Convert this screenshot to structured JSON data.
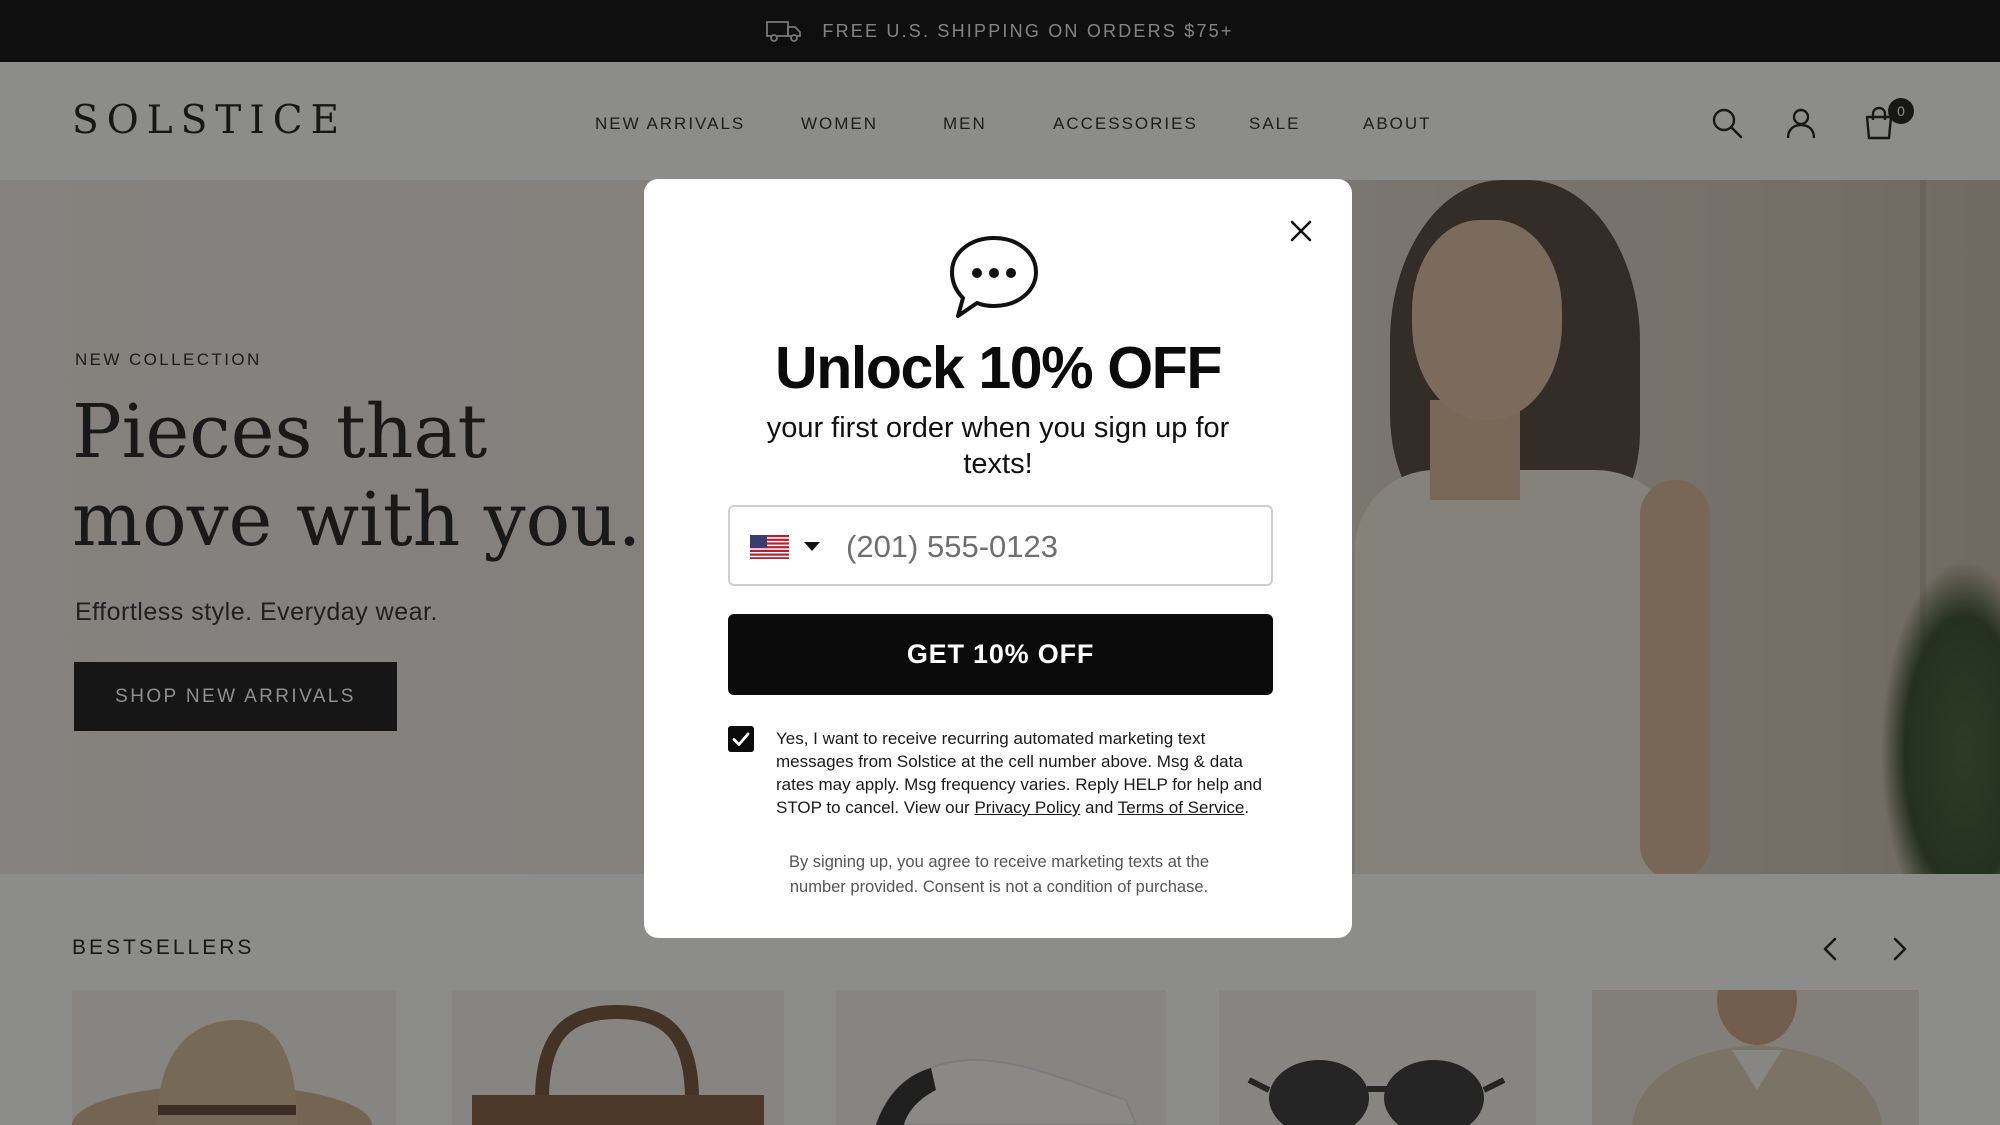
{
  "announcement": {
    "text": "FREE U.S. SHIPPING ON ORDERS $75+",
    "icon": "truck-icon"
  },
  "header": {
    "logo": "SOLSTICE",
    "nav": [
      "NEW ARRIVALS",
      "WOMEN",
      "MEN",
      "ACCESSORIES",
      "SALE",
      "ABOUT"
    ],
    "icons": [
      "search-icon",
      "account-icon",
      "cart-icon"
    ],
    "cart_count": "0"
  },
  "hero": {
    "kicker": "NEW COLLECTION",
    "title": "Pieces that move with you.",
    "subtitle": "Effortless style. Everyday wear.",
    "button": "SHOP NEW ARRIVALS"
  },
  "bestsellers": {
    "title": "BESTSELLERS",
    "products": [
      "hat",
      "tote-bag",
      "sneaker",
      "sunglasses",
      "shirt"
    ]
  },
  "modal": {
    "title": "Unlock 10% OFF",
    "subtitle": "your first order when you sign up for texts!",
    "phone_placeholder": "(201) 555-0123",
    "country": "US",
    "cta": "GET 10% OFF",
    "consent_checked": true,
    "consent_text": "Yes, I want to receive recurring automated marketing text messages from Solstice at the cell number above. Msg & data rates may apply. Msg frequency varies. Reply HELP for help and STOP to cancel. View our ",
    "privacy_link": "Privacy Policy",
    "and_text": " and ",
    "terms_link": "Terms of Service",
    "period": ".",
    "fine_print": "By signing up, you agree to receive marketing texts at the number provided. Consent is not a condition of purchase."
  },
  "colors": {
    "overlay": "#1e1e1e",
    "button": "#0b0b0b",
    "announcement_bg": "#000000"
  }
}
